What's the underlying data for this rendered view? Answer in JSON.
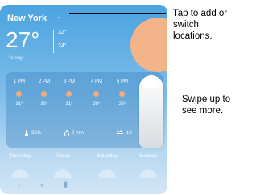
{
  "location": {
    "city": "New York",
    "chevron": "⌄"
  },
  "current": {
    "temp": "27°",
    "high": "32°",
    "low": "24°",
    "condition": "Sunny"
  },
  "hourly": [
    {
      "time": "1 PM",
      "temp": "31°"
    },
    {
      "time": "2 PM",
      "temp": "30°"
    },
    {
      "time": "3 PM",
      "temp": "31°"
    },
    {
      "time": "4 PM",
      "temp": "28°"
    },
    {
      "time": "5 PM",
      "temp": "26°"
    }
  ],
  "stats": {
    "humidity": "36%",
    "precip": "0 mm",
    "wind": "19"
  },
  "daily": [
    "Thursday",
    "Friday",
    "Saturday",
    "Sunday"
  ],
  "callouts": {
    "tap": "Tap to add or\nswitch\nlocations.",
    "swipe": "Swipe up to\nsee more."
  },
  "icons": {
    "back": "‹",
    "home": "○",
    "recent": "⫼"
  },
  "colors": {
    "sky_top": "#4aa3e0",
    "sun": "#f2b488",
    "dot": "#f5aa78"
  }
}
